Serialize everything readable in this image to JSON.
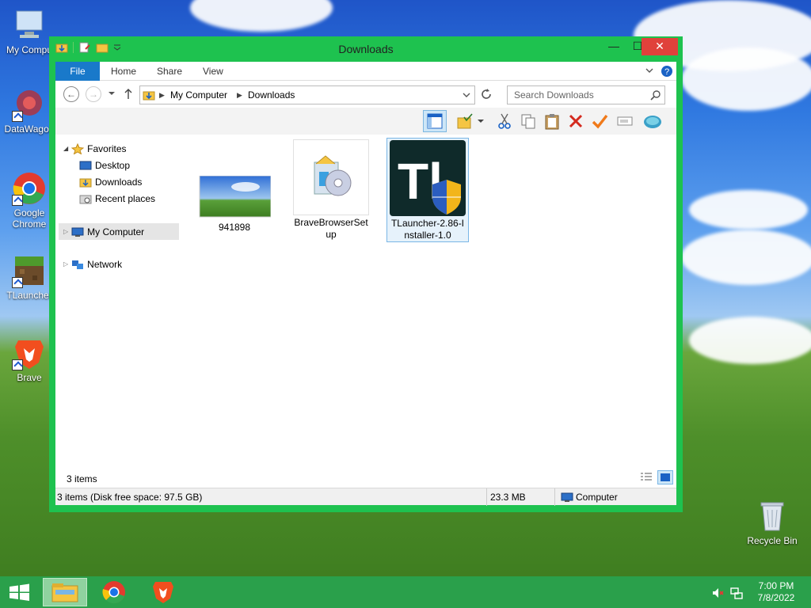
{
  "desktop": {
    "icons": [
      {
        "label": "My Compu"
      },
      {
        "label": "DataWagon"
      },
      {
        "label": "Google Chrome"
      },
      {
        "label": "TLauncher"
      },
      {
        "label": "Brave"
      },
      {
        "label": "Recycle Bin"
      }
    ]
  },
  "window": {
    "title": "Downloads",
    "controls": {
      "minimize": "—",
      "maximize": "☐",
      "close": "✕"
    },
    "ribbon_tabs": [
      "File",
      "Home",
      "Share",
      "View"
    ],
    "address": {
      "crumbs": [
        "My Computer",
        "Downloads"
      ]
    },
    "search": {
      "placeholder": "Search Downloads"
    }
  },
  "navigation": {
    "favorites_label": "Favorites",
    "favorites": [
      "Desktop",
      "Downloads",
      "Recent places"
    ],
    "my_computer": "My Computer",
    "network": "Network"
  },
  "files": [
    {
      "name": "941898"
    },
    {
      "name": "BraveBrowserSetup"
    },
    {
      "name": "TLauncher-2.86-Installer-1.0"
    }
  ],
  "content_footer": {
    "item_count": "3 items"
  },
  "status": {
    "summary": "3 items (Disk free space: 97.5 GB)",
    "size": "23.3 MB",
    "location": "Computer"
  },
  "taskbar": {
    "time": "7:00 PM",
    "date": "7/8/2022"
  },
  "colors": {
    "window_frame": "#1ec24f",
    "file_tab": "#1979ca",
    "close_button": "#e0413b",
    "taskbar": "#2aa04b"
  }
}
